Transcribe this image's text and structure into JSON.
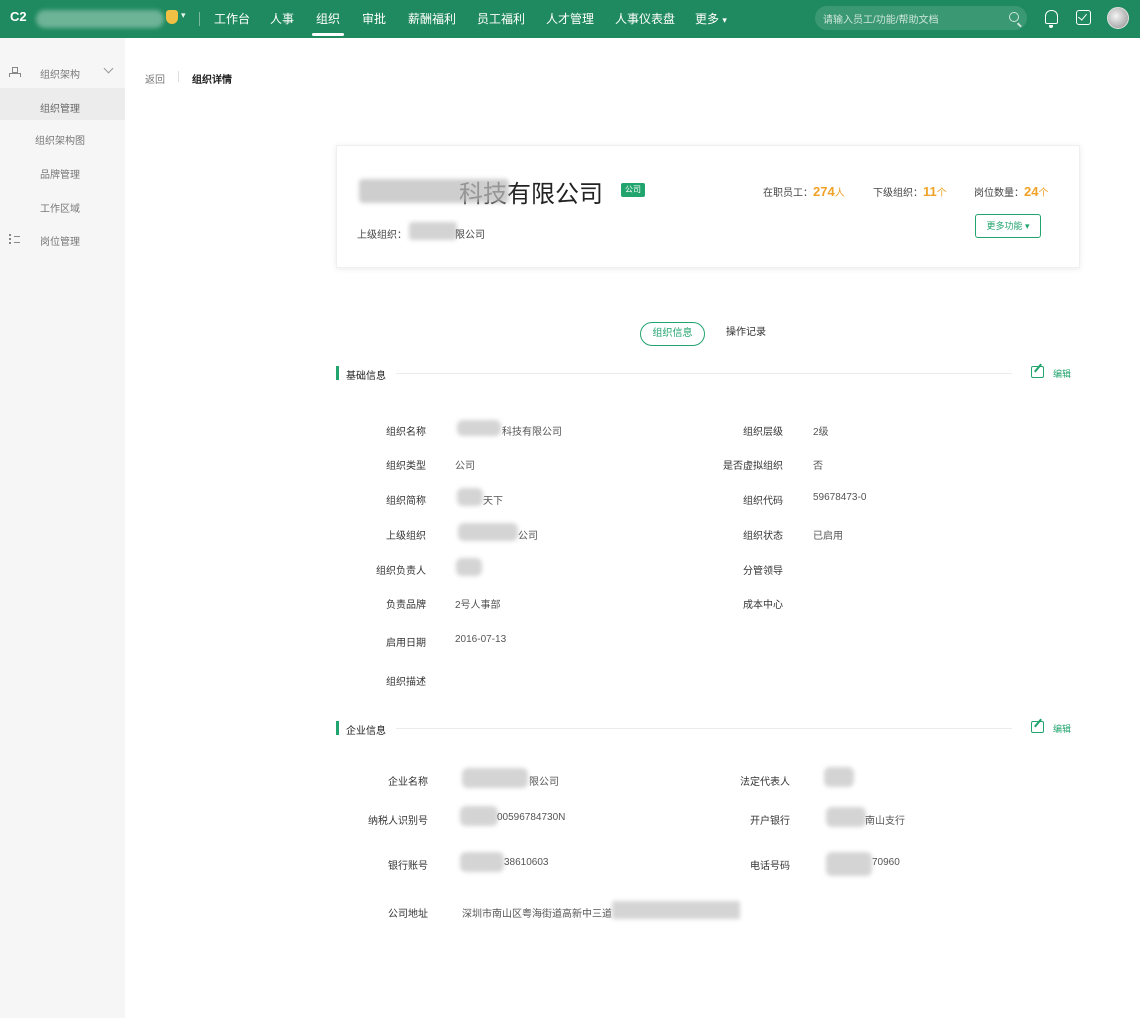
{
  "topbar": {
    "logo": "C2",
    "nav": [
      "工作台",
      "人事",
      "组织",
      "审批",
      "薪酬福利",
      "员工福利",
      "人才管理",
      "人事仪表盘",
      "更多"
    ],
    "active_nav": "组织",
    "search_placeholder": "请输入员工/功能/帮助文档"
  },
  "sidebar": {
    "group_label": "组织架构",
    "items": [
      "组织管理",
      "组织架构图",
      "品牌管理",
      "工作区域"
    ],
    "active_item": "组织管理",
    "position_label": "岗位管理"
  },
  "breadcrumb": {
    "back": "返回",
    "current": "组织详情"
  },
  "header_card": {
    "title": "科技有限公司",
    "type_tag": "公司",
    "parent_label": "上级组织：",
    "parent_value": "限公司",
    "stats": [
      {
        "label": "在职员工：",
        "value": "274",
        "unit": "人"
      },
      {
        "label": "下级组织：",
        "value": "11",
        "unit": "个"
      },
      {
        "label": "岗位数量：",
        "value": "24",
        "unit": "个"
      }
    ],
    "more_button": "更多功能"
  },
  "tabs": [
    "组织信息",
    "操作记录"
  ],
  "basic_section": {
    "title": "基础信息",
    "edit_label": "编辑",
    "left": [
      {
        "label": "组织名称",
        "value": "科技有限公司"
      },
      {
        "label": "组织类型",
        "value": "公司"
      },
      {
        "label": "组织简称",
        "value": "天下"
      },
      {
        "label": "上级组织",
        "value": "公司"
      },
      {
        "label": "组织负责人",
        "value": ""
      },
      {
        "label": "负责品牌",
        "value": "2号人事部"
      },
      {
        "label": "启用日期",
        "value": "2016-07-13"
      },
      {
        "label": "组织描述",
        "value": ""
      }
    ],
    "right": [
      {
        "label": "组织层级",
        "value": "2级"
      },
      {
        "label": "是否虚拟组织",
        "value": "否"
      },
      {
        "label": "组织代码",
        "value": "59678473-0"
      },
      {
        "label": "组织状态",
        "value": "已启用"
      },
      {
        "label": "分管领导",
        "value": ""
      },
      {
        "label": "成本中心",
        "value": ""
      }
    ]
  },
  "enterprise_section": {
    "title": "企业信息",
    "edit_label": "编辑",
    "left": [
      {
        "label": "企业名称",
        "value": "限公司"
      },
      {
        "label": "纳税人识别号",
        "value": "00596784730N"
      },
      {
        "label": "银行账号",
        "value": "38610603"
      },
      {
        "label": "公司地址",
        "value": "深圳市南山区粤海街道高新中三道"
      }
    ],
    "right": [
      {
        "label": "法定代表人",
        "value": ""
      },
      {
        "label": "开户银行",
        "value": "南山支行"
      },
      {
        "label": "电话号码",
        "value": "70960"
      }
    ]
  }
}
